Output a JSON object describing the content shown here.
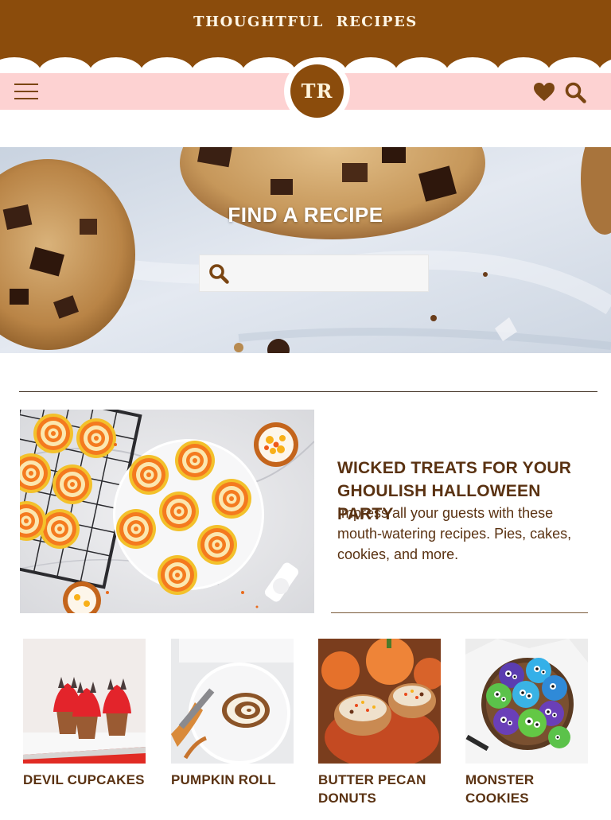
{
  "site": {
    "title": "THOUGHTFUL RECIPES",
    "logo_text": "TR"
  },
  "nav": {
    "menu_icon": "hamburger-menu-icon",
    "favorites_icon": "heart-icon",
    "search_icon": "search-icon"
  },
  "hero": {
    "title": "FIND A RECIPE",
    "search_placeholder": "",
    "search_value": ""
  },
  "feature": {
    "title": "WICKED TREATS FOR YOUR GHOULISH HALLOWEEN PARTY",
    "description": "Impress all your guests with these mouth-watering recipes. Pies, cakes, cookies, and more."
  },
  "recipes": [
    {
      "title": "DEVIL CUPCAKES"
    },
    {
      "title": "PUMPKIN ROLL"
    },
    {
      "title": "BUTTER PECAN DONUTS"
    },
    {
      "title": "MONSTER COOKIES"
    }
  ],
  "colors": {
    "brand_brown": "#8b4c0c",
    "nav_pink": "#fdd2d2",
    "text_brown": "#5a3212"
  }
}
